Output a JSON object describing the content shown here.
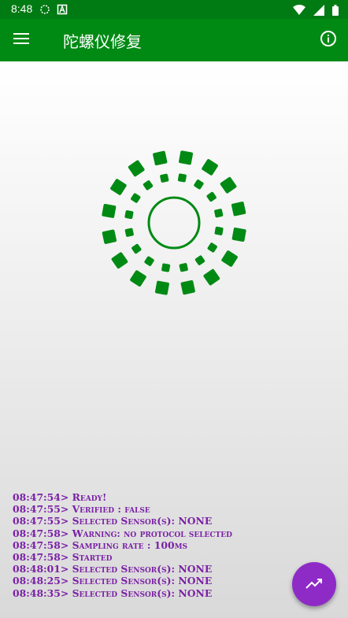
{
  "status_bar": {
    "time": "8:48",
    "icons_left": [
      "sync-icon",
      "accessibility-icon"
    ],
    "icons_right": [
      "wifi-icon",
      "signal-icon",
      "battery-icon"
    ]
  },
  "app_bar": {
    "title": "陀螺仪修复",
    "menu_icon": "hamburger-menu-icon",
    "info_icon": "info-icon",
    "color": "#008a14"
  },
  "log": {
    "lines": [
      "08:47:54> Ready!",
      "08:47:55> Verified : false",
      "08:47:55> Selected Sensor(s): NONE",
      "08:47:58> Warning: no protocol selected",
      "08:47:58> Sampling rate : 100ms",
      "08:47:58> Started",
      "08:48:01> Selected Sensor(s): NONE",
      "08:48:25> Selected Sensor(s): NONE",
      "08:48:35> Selected Sensor(s): NONE"
    ],
    "color": "#7b21a6"
  },
  "fab": {
    "icon": "trending-up-icon",
    "color": "#8e2bc7"
  },
  "gyro": {
    "color": "#008a14",
    "outer_ring_count": 16,
    "inner_ring_count": 16
  }
}
